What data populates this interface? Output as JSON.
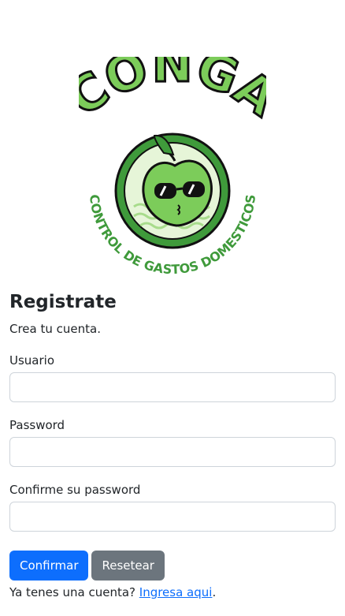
{
  "logo": {
    "wordmark": "CONGA",
    "tagline": "CONTROL DE GASTOS DOMESTICOS"
  },
  "form": {
    "title": "Registrate",
    "subtitle": "Crea tu cuenta.",
    "fields": [
      {
        "label": "Usuario",
        "value": "",
        "placeholder": ""
      },
      {
        "label": "Password",
        "value": "",
        "placeholder": ""
      },
      {
        "label": "Confirme su password",
        "value": "",
        "placeholder": ""
      }
    ],
    "confirm_label": "Confirmar",
    "reset_label": "Resetear",
    "login_prompt": "Ya tenes una cuenta?",
    "login_link": "Ingresa aqui",
    "login_suffix": "."
  },
  "colors": {
    "primary": "#0d6efd",
    "secondary": "#6c757d",
    "brand_green": "#7ccc5a",
    "brand_dark_green": "#3f9a3b"
  }
}
